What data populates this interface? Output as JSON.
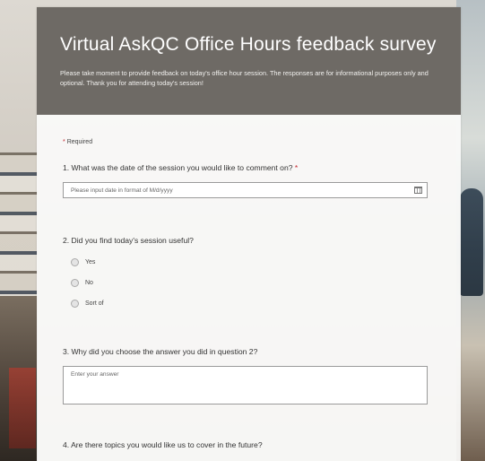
{
  "form": {
    "title": "Virtual AskQC Office Hours feedback survey",
    "description": "Please take moment to provide feedback on today's office hour session. The responses are for informational purposes only and optional. Thank you for attending today's session!",
    "required_star": "*",
    "required_label": "Required"
  },
  "questions": {
    "q1": {
      "label": "1. What was the date of the session you would like to comment on?",
      "required_star": "*",
      "placeholder": "Please input date in format of M/d/yyyy",
      "icon": "calendar-icon"
    },
    "q2": {
      "label": "2. Did you find today's session useful?",
      "options": [
        "Yes",
        "No",
        "Sort of"
      ]
    },
    "q3": {
      "label": "3. Why did you choose the answer you did in question 2?",
      "placeholder": "Enter your answer"
    },
    "q4": {
      "label": "4. Are there topics you would like us to cover in the future?"
    }
  },
  "colors": {
    "header_bg": "#6e6a65",
    "required_star": "#c4262e"
  }
}
